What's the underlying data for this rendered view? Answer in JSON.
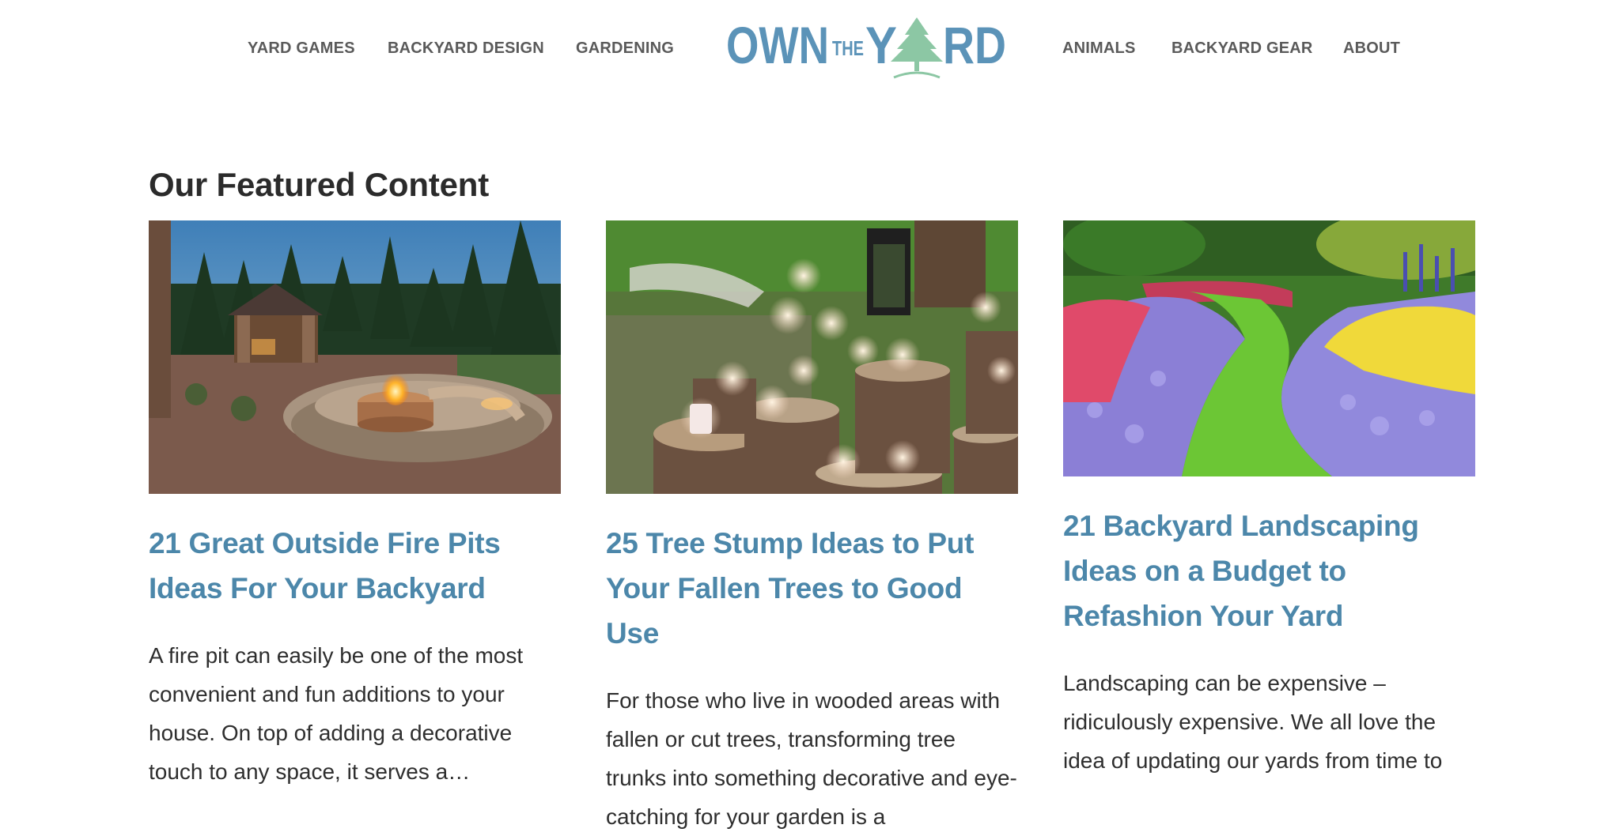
{
  "header": {
    "logo": {
      "word_own": "OWN",
      "word_the": "THE",
      "word_y": "Y",
      "word_rd": "RD",
      "colors": {
        "text": "#5b93b8",
        "tree": "#8cc7a4"
      }
    },
    "nav_left": [
      {
        "label": "YARD GAMES"
      },
      {
        "label": "BACKYARD DESIGN"
      },
      {
        "label": "GARDENING"
      }
    ],
    "nav_right": [
      {
        "label": "ANIMALS"
      },
      {
        "label": "BACKYARD GEAR"
      },
      {
        "label": "ABOUT"
      }
    ]
  },
  "main": {
    "section_title": "Our Featured Content",
    "cards": [
      {
        "image": "backyard fire pit with stone seating wall and gazebo at dusk",
        "title": "21 Great Outside Fire Pits Ideas For Your Backyard",
        "excerpt": "A fire pit can easily be one of the most convenient and fun additions to your house. On top of adding a decorative touch to any space, it serves a…"
      },
      {
        "image": "candles in glass jars on tree stumps",
        "title": "25 Tree Stump Ideas to Put Your Fallen Trees to Good Use",
        "excerpt": "For those who live in wooded areas with fallen or cut trees, transforming tree trunks into something decorative and eye-catching for your garden is a"
      },
      {
        "image": "curved lawn path between colorful flower beds",
        "title": "21 Backyard Landscaping Ideas on a Budget to Refashion Your Yard",
        "excerpt": "Landscaping can be expensive –  ridiculously expensive. We all love the idea of updating our yards from time to"
      }
    ]
  },
  "colors": {
    "link": "#4c87aa",
    "nav_text": "#5a5a5a",
    "heading": "#2b2b2b"
  }
}
